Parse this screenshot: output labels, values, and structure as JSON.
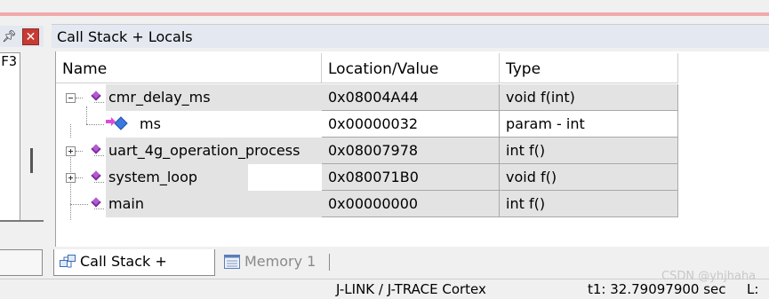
{
  "left_pane": {
    "content_text": "F3"
  },
  "window": {
    "title": "Call Stack + Locals"
  },
  "columns": {
    "name": "Name",
    "location": "Location/Value",
    "type": "Type"
  },
  "rows": [
    {
      "name": "cmr_delay_ms",
      "location": "0x08004A44",
      "type": "void f(int)",
      "expander": "collapse",
      "icon": "function-gem-icon"
    },
    {
      "name": "ms",
      "location": "0x00000032",
      "type": "param - int",
      "icon": "parameter-icon"
    },
    {
      "name": "uart_4g_operation_process",
      "location": "0x08007978",
      "type": "int f()",
      "expander": "expand",
      "icon": "function-gem-icon"
    },
    {
      "name": "system_loop",
      "location": "0x080071B0",
      "type": "void f()",
      "expander": "expand",
      "icon": "function-gem-icon"
    },
    {
      "name": "main",
      "location": "0x00000000",
      "type": "int f()",
      "icon": "function-gem-icon"
    }
  ],
  "tabs": {
    "call_stack": "Call Stack + Locals",
    "memory": "Memory 1"
  },
  "status": {
    "debugger": "J-LINK / J-TRACE Cortex",
    "time": "t1: 32.79097900 sec",
    "extra": "L:"
  },
  "watermark": "CSDN @yhjhaha",
  "colors": {
    "pink_bar": "#f1aaaa",
    "close_button": "#c73b32",
    "function_icon": "#b25bd0",
    "gray_cell": "#e3e3e3"
  }
}
